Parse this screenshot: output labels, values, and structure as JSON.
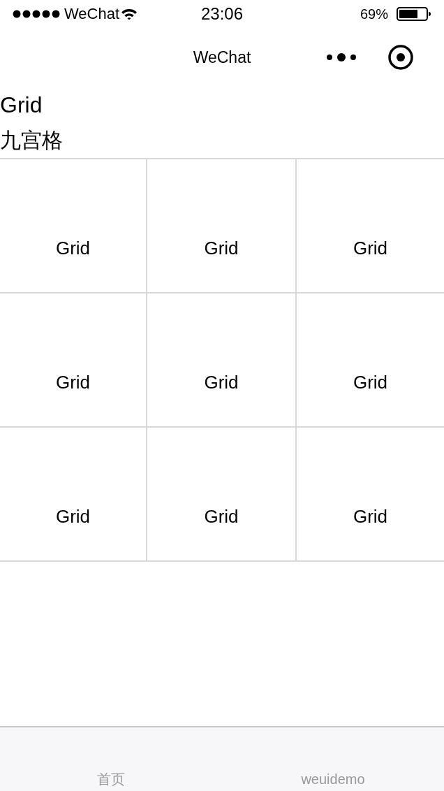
{
  "status_bar": {
    "carrier": "WeChat",
    "time": "23:06",
    "battery": "69%"
  },
  "nav_bar": {
    "title": "WeChat"
  },
  "header": {
    "title": "Grid",
    "subtitle": "九宫格"
  },
  "grid": {
    "cells": [
      "Grid",
      "Grid",
      "Grid",
      "Grid",
      "Grid",
      "Grid",
      "Grid",
      "Grid",
      "Grid"
    ]
  },
  "tab_bar": {
    "items": [
      {
        "label": "首页"
      },
      {
        "label": "weuidemo"
      }
    ]
  }
}
